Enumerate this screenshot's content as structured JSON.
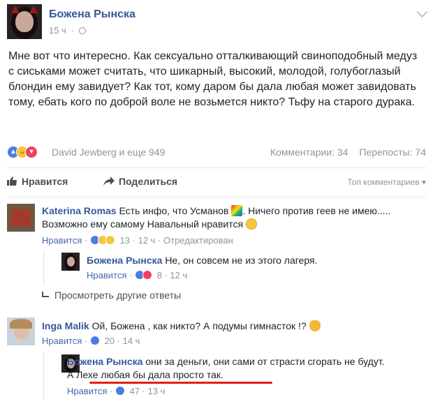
{
  "post": {
    "author": "Божена Рынска",
    "time": "15 ч",
    "text": "Мне вот что интересно. Как сексуально отталкивающий свиноподобный медуз с сиськами может считать, что шикарный, высокий, молодой, голубоглазый блондин ему завидует? Как тот, кому даром бы дала любая может завидовать тому, ебать кого по доброй воле не возьмется никто? Тьфу на старого дурака.",
    "reactors": "David Jewberg и еще 949",
    "comments_count": "Комментарии: 34",
    "shares_count": "Перепосты: 74"
  },
  "actions": {
    "like": "Нравится",
    "share": "Поделиться",
    "top_comments": "Топ комментариев"
  },
  "comments": [
    {
      "name": "Katerina Romas",
      "text_before": "Есть инфо, что Усманов",
      "text_after": ". Ничего против геев не имею..... Возможно ему самому Навальный нравится",
      "like": "Нравится",
      "count": "13",
      "time": "12 ч",
      "edited": "Отредактирован"
    },
    {
      "name": "Божена Рынска",
      "text": "Не, он совсем не из этого лагеря.",
      "like": "Нравится",
      "count": "8",
      "time": "12 ч"
    },
    {
      "name": "Inga Malik",
      "text": "Ой, Божена , как никто? А подумы гимнасток !?",
      "like": "Нравится",
      "count": "20",
      "time": "14 ч"
    },
    {
      "name": "Божена Рынска",
      "text_plain": "они за деньги, они сами от страсти сгорать не будут.",
      "text_underlined": "А Лехе любая бы дала просто так.",
      "like": "Нравится",
      "count": "47",
      "time": "13 ч"
    }
  ],
  "more_replies": "Просмотреть другие ответы",
  "colors": {
    "link_blue": "#365899",
    "muted": "#90949c",
    "like_blue": "#4a7de3",
    "underline_red": "#e21d1d"
  }
}
